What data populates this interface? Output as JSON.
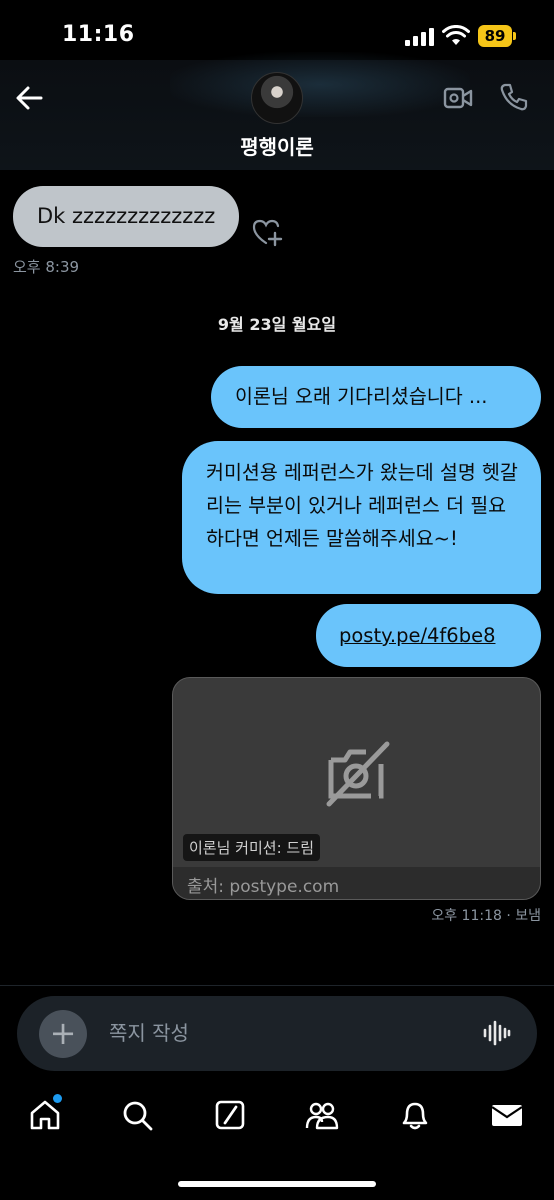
{
  "status_bar": {
    "time": "11:16",
    "battery": "89"
  },
  "header": {
    "contact_name": "평행이론"
  },
  "messages": {
    "received": {
      "text": "Dk zzzzzzzzzzzzz",
      "time": "오후 8:39"
    },
    "date_separator": "9월 23일 월요일",
    "sent": [
      {
        "text": "이론님 오래 기다리셨습니다 ..."
      },
      {
        "text": "커미션용 레퍼런스가 왔는데 설명 헷갈리는 부분이 있거나 레퍼런스 더 필요하다면 언제든 말씀해주세요~!"
      },
      {
        "text": "posty.pe/4f6be8"
      }
    ],
    "link_card": {
      "title": "이론님 커미션: 드림",
      "source": "출처: postype.com"
    },
    "sent_status": "오후 11:18 · 보냄"
  },
  "composer": {
    "placeholder": "쪽지 작성"
  },
  "nav": {
    "items": [
      "home-icon",
      "search-icon",
      "grok-icon",
      "communities-icon",
      "notifications-icon",
      "messages-icon"
    ]
  },
  "colors": {
    "sent_bubble": "#6ac4fb",
    "received_bubble": "#bfc5ca",
    "accent": "#1d9bf0",
    "battery": "#f5c518"
  }
}
